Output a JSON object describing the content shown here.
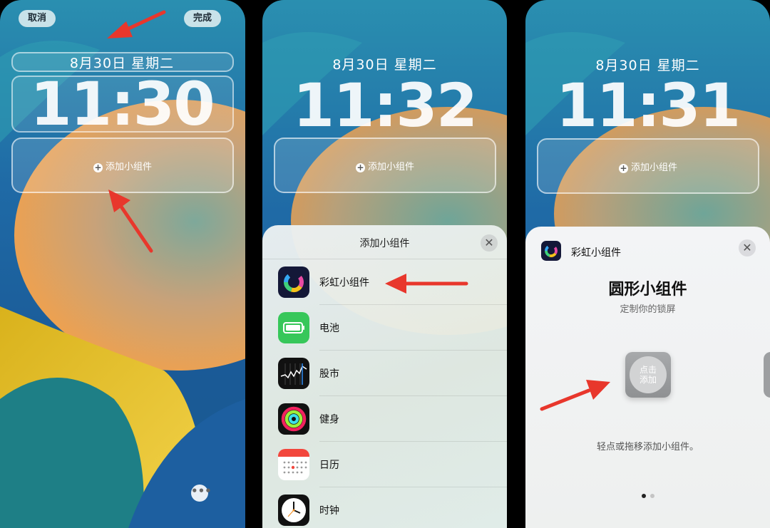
{
  "panel1": {
    "cancel_label": "取消",
    "done_label": "完成",
    "date": "8月30日 星期二",
    "time": "11:30",
    "add_widget": "添加小组件",
    "more_icon": "ellipsis-icon"
  },
  "panel2": {
    "date": "8月30日 星期二",
    "time": "11:32",
    "add_widget": "添加小组件",
    "sheet_title": "添加小组件",
    "apps": [
      {
        "label": "彩虹小组件",
        "icon": "rainbow-widget-icon"
      },
      {
        "label": "电池",
        "icon": "battery-icon"
      },
      {
        "label": "股市",
        "icon": "stocks-icon"
      },
      {
        "label": "健身",
        "icon": "fitness-icon"
      },
      {
        "label": "日历",
        "icon": "calendar-icon"
      },
      {
        "label": "时钟",
        "icon": "clock-icon"
      }
    ]
  },
  "panel3": {
    "date": "8月30日 星期二",
    "time": "11:31",
    "add_widget": "添加小组件",
    "app_name": "彩虹小组件",
    "widget_title": "圆形小组件",
    "widget_subtitle": "定制你的锁屏",
    "tap_line1": "点击",
    "tap_line2": "添加",
    "hint": "轻点或拖移添加小组件。",
    "page_indicator": {
      "current": 1,
      "total": 2
    }
  },
  "colors": {
    "arrow": "#e8372c",
    "wallpaper_blue": "#1d67a8",
    "wallpaper_orange": "#f3a14c",
    "wallpaper_yellow": "#e7c21c"
  }
}
